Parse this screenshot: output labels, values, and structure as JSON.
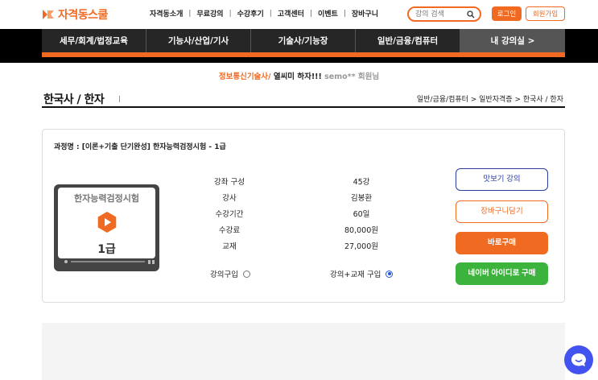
{
  "header": {
    "logo_text": "자격동스쿨",
    "nav": [
      "자격동소개",
      "무료강의",
      "수강후기",
      "고객센터",
      "이벤트",
      "장바구니"
    ],
    "search_placeholder": "강의 검색",
    "login_label": "로그인",
    "join_label": "회원가입"
  },
  "main_nav": {
    "tabs": [
      "세무/회계/법정교육",
      "기능사/산업/기사",
      "기술사/기능장",
      "일반/금융/컴퓨터",
      "내 강의실  >"
    ],
    "active_index": 4
  },
  "greeting": {
    "highlight": "정보통신기술사/",
    "text": " 열씨미 하자!!!",
    "user": " semo** 회원님"
  },
  "page": {
    "title": "한국사 / 한자",
    "separator": "|",
    "breadcrumb": "일반/금융/컴퓨터 > 일반자격증 > 한국사 / 한자"
  },
  "course": {
    "name": "과정명 : [이론+기출 단기완성] 한자능력검정시험 - 1급",
    "thumbnail_title": "한자능력검정시험",
    "thumbnail_grade": "1급",
    "details": [
      {
        "label": "강좌 구성",
        "value": "45강"
      },
      {
        "label": "강사",
        "value": "김봉환"
      },
      {
        "label": "수강기간",
        "value": "60일"
      },
      {
        "label": "수강료",
        "value": "80,000원"
      },
      {
        "label": "교재",
        "value": "27,000원"
      }
    ],
    "options": [
      {
        "label": "강의구입",
        "selected": false
      },
      {
        "label": "강의+교재 구입",
        "selected": true
      }
    ],
    "buttons": {
      "sample": "맛보기 강의",
      "cart": "장바구니담기",
      "buy": "바로구매",
      "naver": "네이버 아이디로 구매"
    }
  },
  "colors": {
    "brand_orange": "#f06a22",
    "naver_green": "#3cb33c",
    "chat_blue": "#4353f0"
  }
}
